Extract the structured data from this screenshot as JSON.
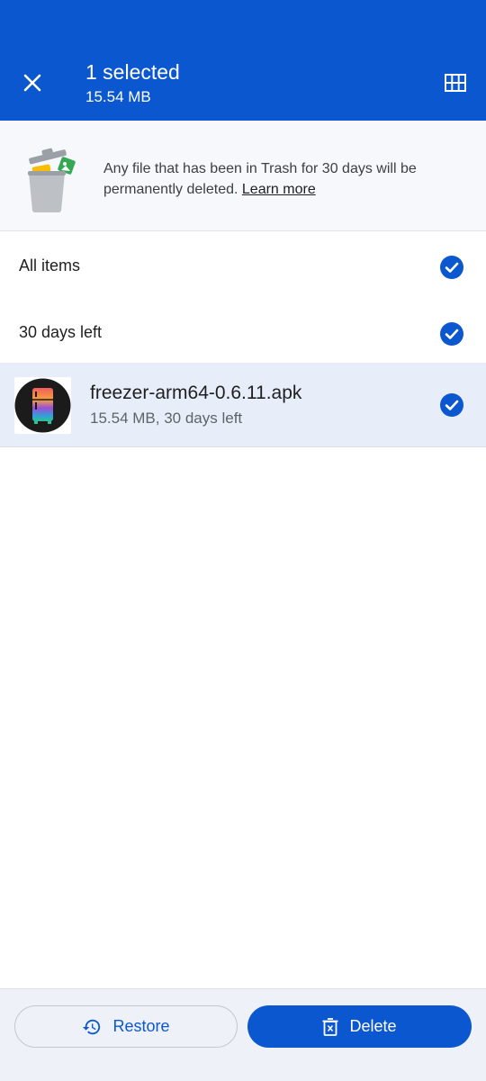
{
  "appbar": {
    "title": "1 selected",
    "subtitle": "15.54 MB",
    "close_icon": "close-icon",
    "view_icon": "grid-view-icon"
  },
  "banner": {
    "text": "Any file that has been in Trash for 30 days will be permanently deleted.",
    "link": "Learn more",
    "illustration": "trash-can-illustration"
  },
  "groups": [
    {
      "label": "All items",
      "checked": true
    },
    {
      "label": "30 days left",
      "checked": true
    }
  ],
  "file": {
    "name": "freezer-arm64-0.6.11.apk",
    "meta": "15.54 MB, 30 days left",
    "checked": true,
    "icon": "freezer-app-icon"
  },
  "actions": {
    "restore_label": "Restore",
    "delete_label": "Delete"
  },
  "colors": {
    "primary": "#0b57d0",
    "selected_row": "#e8eef9",
    "banner_bg": "#f6f8fb"
  }
}
